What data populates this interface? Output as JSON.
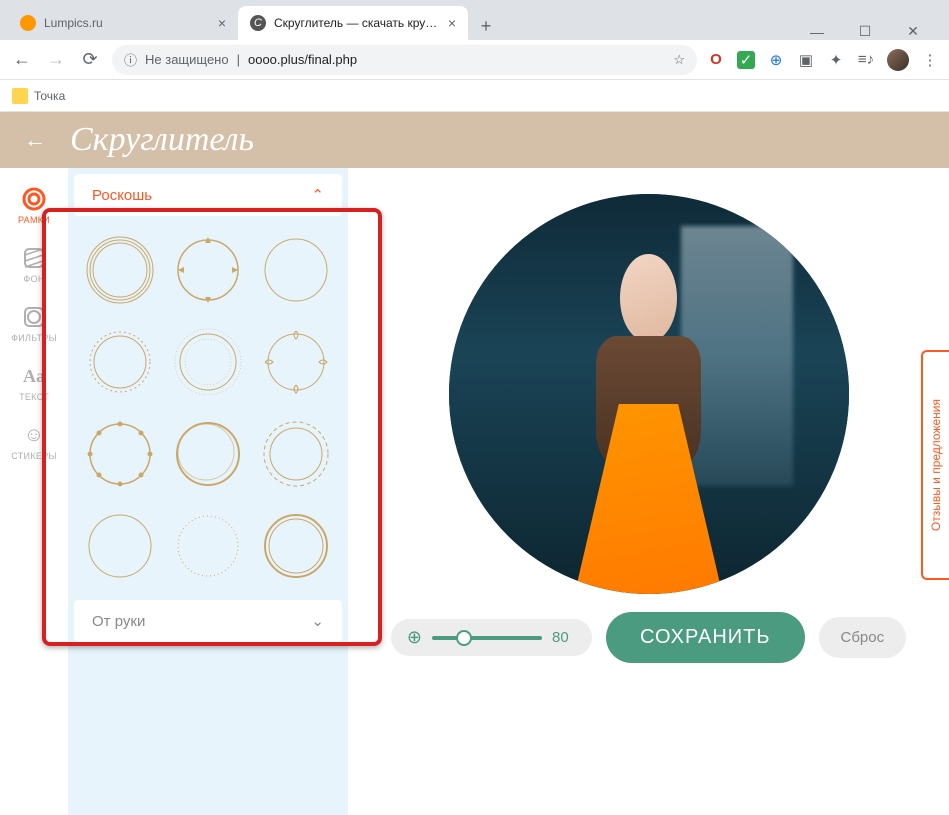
{
  "browser": {
    "tabs": [
      {
        "title": "Lumpics.ru",
        "favicon_color": "#ff9800",
        "active": false
      },
      {
        "title": "Скруглитель — скачать круглу...",
        "favicon_letter": "C",
        "active": true
      }
    ],
    "security_label": "Не защищено",
    "url": "oooo.plus/final.php",
    "bookmark_label": "Точка"
  },
  "app": {
    "title": "Скруглитель",
    "tools": [
      {
        "id": "frames",
        "label": "РАМКИ",
        "active": true
      },
      {
        "id": "bg",
        "label": "ФОН",
        "active": false
      },
      {
        "id": "filters",
        "label": "ФИЛЬТРЫ",
        "active": false
      },
      {
        "id": "text",
        "label": "ТЕКСТ",
        "active": false
      },
      {
        "id": "stickers",
        "label": "СТИКЕРЫ",
        "active": false
      }
    ],
    "frames_panel": {
      "active_category": "Роскошь",
      "next_category": "От руки"
    },
    "zoom_value": "80",
    "save_label": "СОХРАНИТЬ",
    "reset_label": "Сброс",
    "feedback_label": "Отзывы и предложения"
  }
}
